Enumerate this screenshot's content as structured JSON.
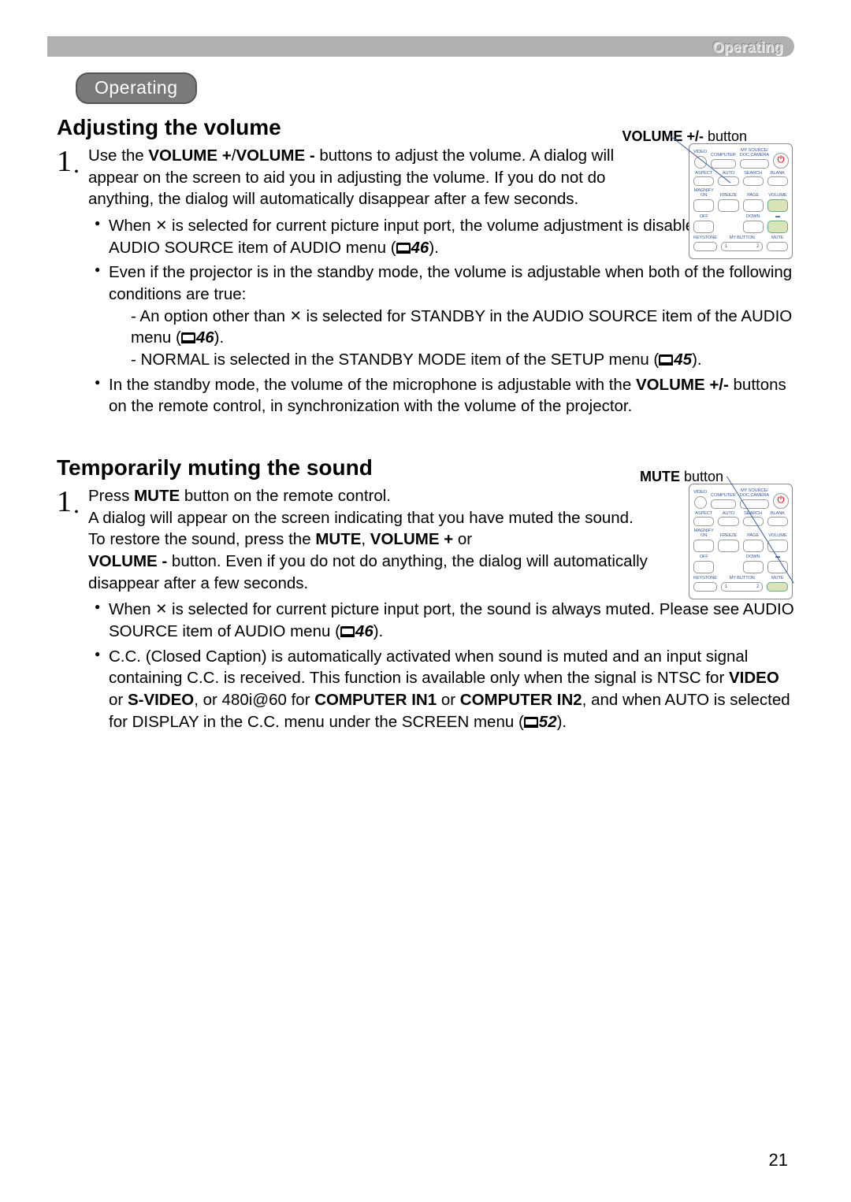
{
  "page_number": "21",
  "header": {
    "right_label": "Operating"
  },
  "pill": "Operating",
  "section1": {
    "title": "Adjusting the volume",
    "callout_bold": "VOLUME +/-",
    "callout_rest": " button",
    "step_num": "1",
    "step_text_a": "Use the ",
    "step_bold_a": "VOLUME +",
    "step_text_b": "/",
    "step_bold_b": "VOLUME -",
    "step_text_c": " buttons to adjust the volume. A dialog will appear on the screen to aid you in adjusting the volume. If you do not do anything, the dialog will automatically disappear after a few seconds.",
    "bullet1_a": "When ",
    "bullet1_b": " is selected for current picture input port, the volume adjustment is disabled. Please see AUDIO SOURCE item of AUDIO menu (",
    "ref1": "46",
    "bullet1_c": ").",
    "bullet2_a": "Even if the projector is in the standby mode, the volume is adjustable when both of the following conditions are true:",
    "sub1_a": "- An option other than ",
    "sub1_b": " is selected for STANDBY in the AUDIO SOURCE item of the AUDIO menu (",
    "ref2": "46",
    "sub1_c": ").",
    "sub2_a": "- NORMAL is selected in the STANDBY MODE item of the SETUP menu (",
    "ref3": "45",
    "sub2_b": ").",
    "bullet3_a": "In the standby mode, the volume of the microphone is adjustable with the ",
    "bullet3_bold": "VOLUME +/-",
    "bullet3_b": " buttons on the remote control, in synchronization with the volume of the projector."
  },
  "section2": {
    "title": "Temporarily muting the sound",
    "callout_bold": "MUTE",
    "callout_rest": " button",
    "step_num": "1",
    "step_a": "Press ",
    "step_bold_a": "MUTE",
    "step_b": " button on the remote control.",
    "step_c": "A dialog will appear on the screen indicating that you have muted the sound.",
    "step_d": "To restore the sound, press the  ",
    "step_bold_b": "MUTE",
    "step_e": ", ",
    "step_bold_c": "VOLUME +",
    "step_f": " or ",
    "step_bold_d": "VOLUME -",
    "step_g": " button. Even if you do not do anything, the dialog will automatically disappear after a few seconds.",
    "bullet1_a": "When ",
    "bullet1_b": " is selected for current picture input port, the sound is always muted. Please see AUDIO SOURCE item of AUDIO menu (",
    "ref1": "46",
    "bullet1_c": ").",
    "bullet2_a": "C.C. (Closed Caption) is automatically activated when sound is muted and an input signal containing C.C. is received. This function is available only when the signal is NTSC for ",
    "bullet2_bold_a": "VIDEO",
    "bullet2_b": " or ",
    "bullet2_bold_b": "S-VIDEO",
    "bullet2_c": ", or 480i@60 for ",
    "bullet2_bold_c": "COMPUTER IN1",
    "bullet2_d": " or ",
    "bullet2_bold_d": "COMPUTER IN2",
    "bullet2_e": ", and when AUTO is selected for DISPLAY in the C.C. menu under the SCREEN menu (",
    "ref2": "52",
    "bullet2_f": ")."
  },
  "remote": {
    "row1": [
      "VIDEO",
      "COMPUTER",
      "MY SOURCE/\nDOC.CAMERA"
    ],
    "row2": [
      "ASPECT",
      "AUTO",
      "SEARCH",
      "BLANK"
    ],
    "row3_left": [
      "MAGNIFY",
      "ON"
    ],
    "row3": [
      "FREEZE",
      "PAGE",
      "VOLUME"
    ],
    "row4_left": "OFF",
    "row4": [
      "",
      "DOWN",
      ""
    ],
    "row5": [
      "KEYSTONE",
      "MY BUTTON",
      "MUTE"
    ],
    "mybutton_nums": [
      "1",
      "2"
    ]
  }
}
